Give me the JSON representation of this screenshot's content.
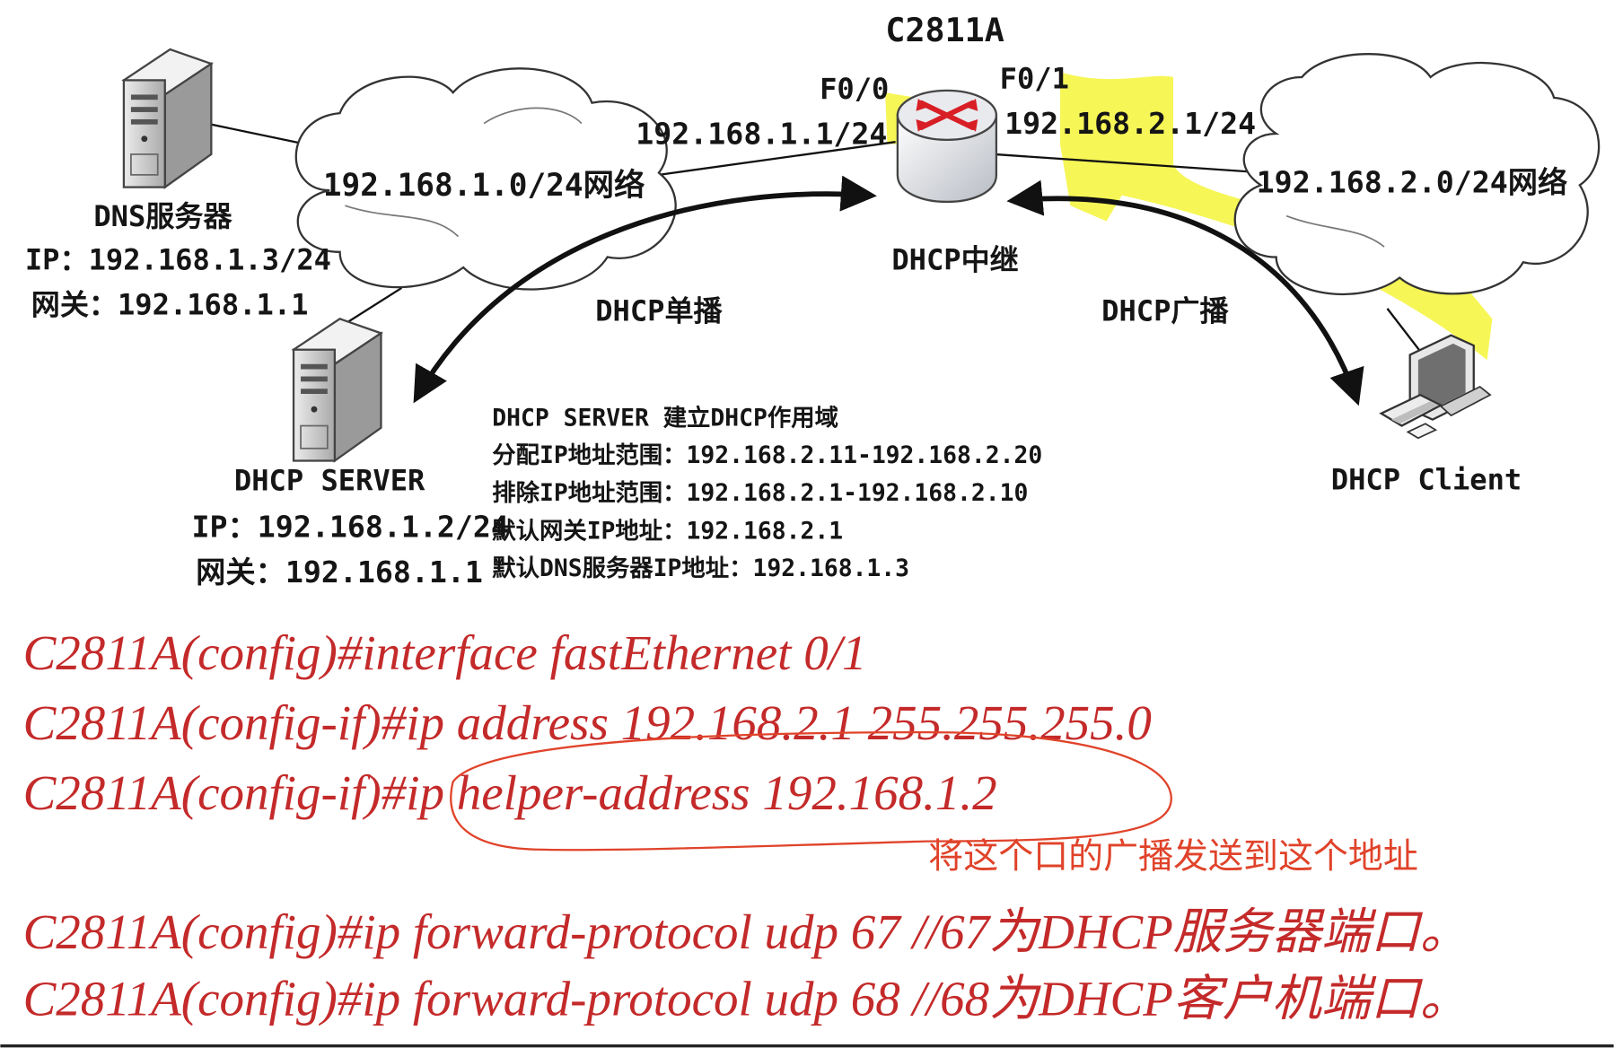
{
  "topology": {
    "router": {
      "name": "C2811A",
      "role_label": "DHCP中继",
      "port_left": "F0/0",
      "port_left_ip": "192.168.1.1/24",
      "port_right": "F0/1",
      "port_right_ip": "192.168.2.1/24"
    },
    "network_left": "192.168.1.0/24网络",
    "network_right": "192.168.2.0/24网络",
    "dns_server": {
      "name": "DNS服务器",
      "ip": "IP：192.168.1.3/24",
      "gateway": "网关：192.168.1.1"
    },
    "dhcp_server": {
      "name": "DHCP SERVER",
      "ip": "IP：192.168.1.2/24",
      "gateway": "网关：192.168.1.1"
    },
    "dhcp_client": {
      "name": "DHCP Client"
    },
    "arrows": {
      "unicast": "DHCP单播",
      "broadcast": "DHCP广播"
    },
    "scope_info": [
      "DHCP SERVER 建立DHCP作用域",
      "分配IP地址范围：192.168.2.11-192.168.2.20",
      "排除IP地址范围：192.168.2.1-192.168.2.10",
      "默认网关IP地址：192.168.2.1",
      "默认DNS服务器IP地址：192.168.1.3"
    ]
  },
  "commands": [
    "C2811A(config)#interface fastEthernet 0/1",
    "C2811A(config-if)#ip address 192.168.2.1 255.255.255.0",
    "C2811A(config-if)#ip helper-address 192.168.1.2",
    "C2811A(config)#ip forward-protocol udp 67 //67为DHCP服务器端口。",
    "C2811A(config)#ip forward-protocol udp 68 //68为DHCP客户机端口。"
  ],
  "annotation": {
    "text": "将这个口的广播发送到这个地址",
    "color": "#e0432a"
  },
  "colors": {
    "command_text": "#c42a2a",
    "highlight": "#f5f53a",
    "router_arrows": "#d81f26"
  }
}
